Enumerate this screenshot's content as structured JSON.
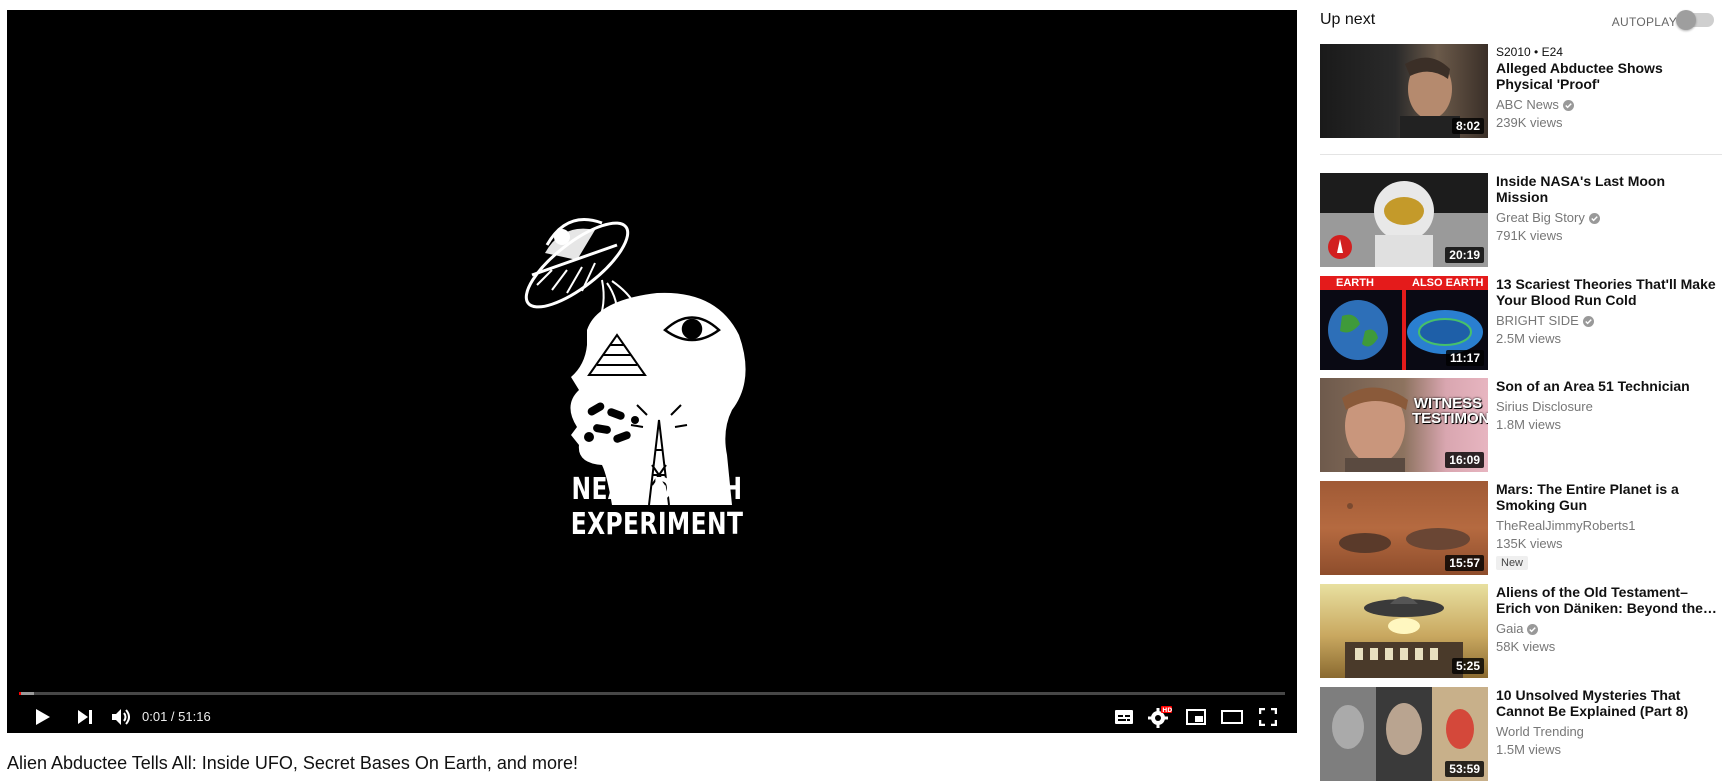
{
  "player": {
    "current_time": "0:01",
    "separator": " / ",
    "duration": "51:16",
    "progress_played_fraction": 0.0003,
    "progress_loaded_fraction": 0.012,
    "overlay_title": "NEAR DEATH EXPERIMENT"
  },
  "video": {
    "title": "Alien Abductee Tells All: Inside UFO, Secret Bases On Earth, and more!"
  },
  "sidebar": {
    "upnext_label": "Up next",
    "autoplay_label": "AUTOPLAY",
    "items": [
      {
        "episode": "S2010 • E24",
        "title": "Alleged Abductee Shows Physical 'Proof'",
        "channel": "ABC News",
        "verified": true,
        "views": "239K views",
        "duration": "8:02"
      },
      {
        "title": "Inside NASA's Last Moon Mission",
        "channel": "Great Big Story",
        "verified": true,
        "views": "791K views",
        "duration": "20:19"
      },
      {
        "title": "13 Scariest Theories That'll Make Your Blood Run Cold",
        "channel": "BRIGHT SIDE",
        "verified": true,
        "views": "2.5M views",
        "duration": "11:17",
        "thumb_text_left": "EARTH",
        "thumb_text_right": "ALSO EARTH"
      },
      {
        "title": "Son of an Area 51 Technician",
        "channel": "Sirius Disclosure",
        "verified": false,
        "views": "1.8M views",
        "duration": "16:09",
        "thumb_text": "WITNESS TESTIMONY"
      },
      {
        "title": "Mars: The Entire Planet is a Smoking Gun",
        "channel": "TheRealJimmyRoberts1",
        "verified": false,
        "views": "135K views",
        "badge": "New",
        "duration": "15:57"
      },
      {
        "title": "Aliens of the Old Testament– Erich von Däniken: Beyond the…",
        "channel": "Gaia",
        "verified": true,
        "views": "58K views",
        "duration": "5:25"
      },
      {
        "title": "10 Unsolved Mysteries That Cannot Be Explained (Part 8)",
        "channel": "World Trending",
        "verified": false,
        "views": "1.5M views",
        "duration": "53:59"
      }
    ]
  },
  "icons": [
    "play-icon",
    "next-icon",
    "volume-icon",
    "subtitles-icon",
    "settings-hd-icon",
    "miniplayer-icon",
    "theater-mode-icon",
    "fullscreen-icon",
    "verified-icon"
  ],
  "colors": {
    "progress_played": "#ff0000",
    "player_bg": "#000000"
  }
}
